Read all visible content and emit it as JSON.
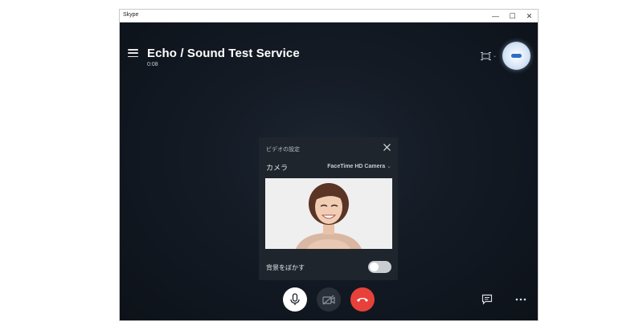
{
  "window": {
    "app_title": "Skype",
    "controls": {
      "minimize": "—",
      "maximize": "☐",
      "close": "✕"
    }
  },
  "call": {
    "title": "Echo / Sound Test Service",
    "duration": "0:08"
  },
  "video_settings": {
    "title": "ビデオの設定",
    "camera_label": "カメラ",
    "camera_value": "FaceTime HD Camera",
    "blur_label": "背景をぼかす",
    "blur_enabled": false
  },
  "controls": {
    "end_call_color": "#e8413b",
    "accent": "#2d6fc4"
  },
  "icons": {
    "menu": "hamburger-icon",
    "layout": "layout-icon",
    "close": "close-icon",
    "mic": "microphone-icon",
    "video_off": "video-off-icon",
    "end_call": "end-call-icon",
    "chat": "chat-icon",
    "more": "more-icon"
  }
}
